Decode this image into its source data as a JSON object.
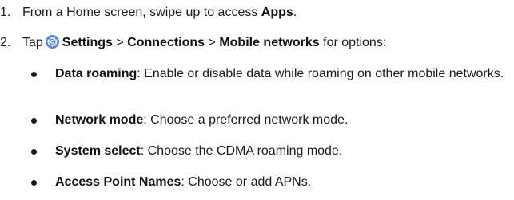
{
  "steps": [
    {
      "number": "1.",
      "prefix": "From a Home screen, swipe up to access ",
      "bold": "Apps",
      "suffix": "."
    },
    {
      "number": "2.",
      "prefix": "Tap",
      "icon": "settings-gear-icon",
      "path": [
        "Settings",
        "Connections",
        "Mobile networks"
      ],
      "separator": ">",
      "suffix": " for options:"
    }
  ],
  "options": [
    {
      "term": "Data roaming",
      "description": ": Enable or disable data while roaming on other mobile networks."
    },
    {
      "term": "Network mode",
      "description": ": Choose a preferred network mode."
    },
    {
      "term": "System select",
      "description": ": Choose the CDMA roaming mode."
    },
    {
      "term": "Access Point Names",
      "description": ": Choose or add APNs."
    }
  ],
  "colors": {
    "icon_background": "#5a86e0",
    "text": "#1a1a1a"
  }
}
